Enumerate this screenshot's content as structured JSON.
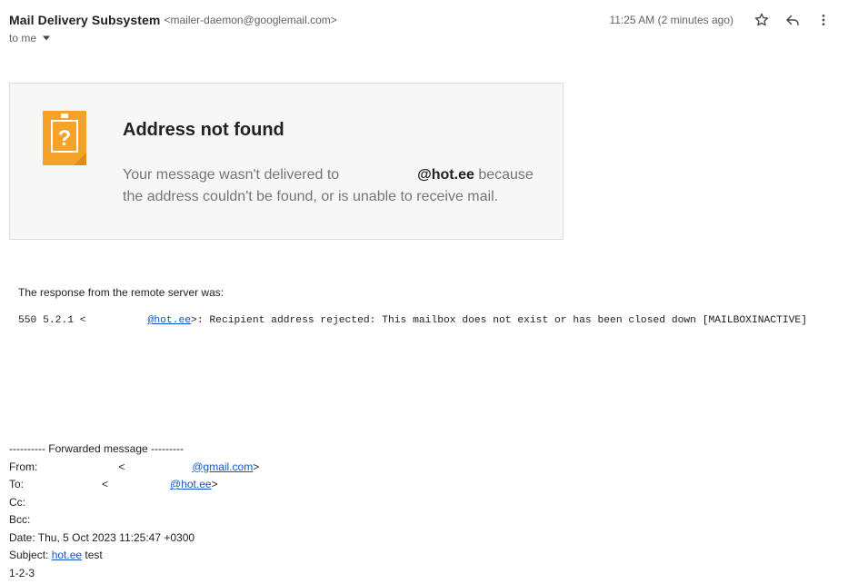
{
  "header": {
    "sender_name": "Mail Delivery Subsystem",
    "sender_email": "<mailer-daemon@googlemail.com>",
    "timestamp": "11:25 AM (2 minutes ago)",
    "to_label": "to me",
    "icons": {
      "star": "star-icon",
      "reply": "reply-icon",
      "more": "more-vert-icon",
      "dropdown": "caret-down-icon"
    }
  },
  "card": {
    "icon": "question-note-icon",
    "title": "Address not found",
    "body_prefix": "Your message wasn't delivered to",
    "domain": "@hot.ee",
    "body_suffix": "because the address couldn't be found, or is unable to receive mail.",
    "colors": {
      "icon_orange": "#f4a228",
      "icon_dark": "#e8891b"
    }
  },
  "response": {
    "intro": "The response from the remote server was:",
    "code_prefix": "550 5.2.1 <",
    "address_domain": "@hot.ee",
    "code_suffix": ">: Recipient address rejected: This mailbox does not exist or has been closed down [MAILBOXINACTIVE]"
  },
  "forwarded": {
    "separator": "---------- Forwarded message ---------",
    "from_label": "From:",
    "from_lt": "<",
    "from_link": "@gmail.com",
    "from_gt": ">",
    "to_label": "To:",
    "to_lt": "<",
    "to_link": "@hot.ee",
    "to_gt": ">",
    "cc_label": "Cc:",
    "bcc_label": "Bcc:",
    "date_line": "Date: Thu, 5 Oct 2023 11:25:47 +0300",
    "subject_label": "Subject:",
    "subject_link": "hot.ee",
    "subject_rest": "test",
    "body": "1-2-3"
  }
}
